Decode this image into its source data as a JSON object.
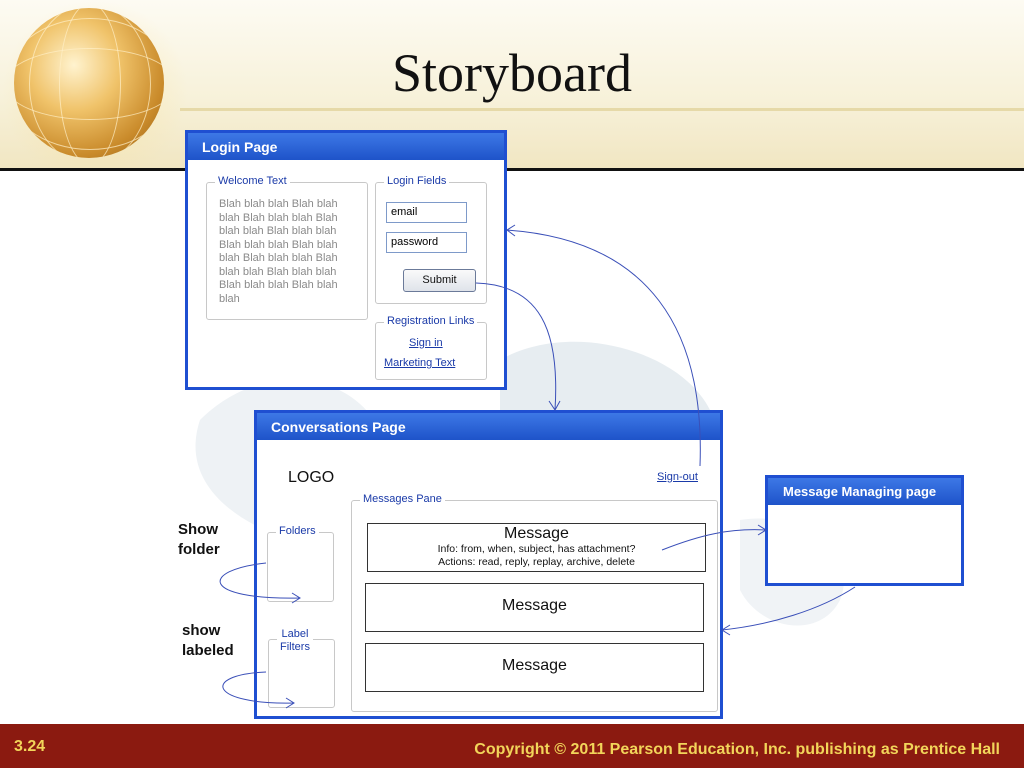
{
  "slide": {
    "title": "Storyboard",
    "number": "3.24",
    "copyright": "Copyright © 2011 Pearson Education, Inc. publishing as Prentice Hall"
  },
  "login_page": {
    "title": "Login Page",
    "welcome_legend": "Welcome Text",
    "welcome_lines": [
      "Blah blah blah Blah blah",
      "blah Blah blah blah Blah",
      "blah blah Blah blah blah",
      "Blah blah blah Blah blah",
      "blah Blah blah blah Blah",
      "blah blah Blah blah blah",
      "Blah blah blah Blah blah",
      "blah"
    ],
    "login_legend": "Login Fields",
    "email_value": "email",
    "password_value": "password",
    "submit_label": "Submit",
    "registration_legend": "Registration Links",
    "sign_in_link": "Sign in",
    "marketing_link": "Marketing Text"
  },
  "conversations_page": {
    "title": "Conversations Page",
    "logo": "LOGO",
    "sign_out_link": "Sign-out",
    "folders_legend": "Folders",
    "label_filters_legend_1": "Label",
    "label_filters_legend_2": "Filters",
    "messages_legend": "Messages Pane",
    "messages": [
      {
        "title": "Message",
        "info": "Info: from, when, subject, has attachment?",
        "actions": "Actions: read, reply, replay, archive, delete"
      },
      {
        "title": "Message"
      },
      {
        "title": "Message"
      }
    ]
  },
  "message_managing_page": {
    "title": "Message Managing page"
  },
  "annotations": {
    "show_folder_1": "Show",
    "show_folder_2": "folder",
    "show_labeled_1": "show",
    "show_labeled_2": "labeled"
  },
  "colors": {
    "window_border": "#1f4fd1",
    "footer_bg": "#8b1a10",
    "footer_text": "#f2d55a",
    "arrow": "#3a4fb8"
  }
}
